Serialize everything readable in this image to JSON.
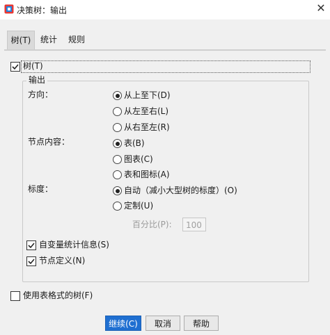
{
  "window": {
    "title": "决策树：输出",
    "close_glyph": "✕"
  },
  "tabs": [
    {
      "label": "树(T)",
      "active": true
    },
    {
      "label": "统计",
      "active": false
    },
    {
      "label": "规则",
      "active": false
    }
  ],
  "tree_checkbox": {
    "label": "树(T)",
    "checked": true
  },
  "output_group": {
    "title": "输出",
    "direction": {
      "label": "方向：",
      "options": [
        {
          "label": "从上至下(D)",
          "selected": true
        },
        {
          "label": "从左至右(L)",
          "selected": false
        },
        {
          "label": "从右至左(R)",
          "selected": false
        }
      ]
    },
    "node_content": {
      "label": "节点内容：",
      "options": [
        {
          "label": "表(B)",
          "selected": true
        },
        {
          "label": "图表(C)",
          "selected": false
        },
        {
          "label": "表和图标(A)",
          "selected": false
        }
      ]
    },
    "scale": {
      "label": "标度：",
      "options": [
        {
          "label": "自动（减小大型树的标度）(O)",
          "selected": true
        },
        {
          "label": "定制(U)",
          "selected": false
        }
      ],
      "percent_label": "百分比(P):",
      "percent_value": "100"
    },
    "checkboxes": [
      {
        "label": "自变量统计信息(S)",
        "checked": true
      },
      {
        "label": "节点定义(N)",
        "checked": true
      }
    ]
  },
  "table_format_checkbox": {
    "label": "使用表格式的树(F)",
    "checked": false
  },
  "buttons": {
    "continue": "继续(C)",
    "cancel": "取消",
    "help": "帮助"
  },
  "colors": {
    "primary_button": "#1f6fd1",
    "dialog_bg": "#f0f0f0"
  }
}
